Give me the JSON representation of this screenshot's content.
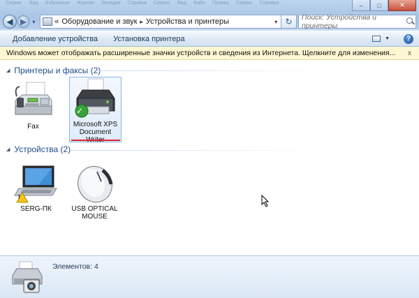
{
  "window": {
    "ghost_menu": [
      "Сервис",
      "Вид",
      "Избранное",
      "Журнал",
      "Вкладки",
      "Справка",
      "Сервис",
      "Вид",
      "Файл",
      "Правка",
      "Сервис",
      "Справка"
    ],
    "controls": [
      "–",
      "□",
      "✕"
    ]
  },
  "nav": {
    "back_glyph": "◀",
    "forward_glyph": "▶",
    "history_glyph": "▾"
  },
  "address": {
    "overflow": "«",
    "crumbs": [
      "Оборудование и звук",
      "Устройства и принтеры"
    ],
    "separator": "▸",
    "dropdown_glyph": "▾",
    "refresh_glyph": "↻"
  },
  "search": {
    "placeholder": "Поиск: Устройства и принтеры"
  },
  "commands": {
    "add_device": "Добавление устройства",
    "add_printer": "Установка принтера",
    "help": "?",
    "view_drop": "▼"
  },
  "infobar": {
    "text": "Windows может отображать расширенные значки устройств и сведения из Интернета.  Щелкните для изменения...",
    "close": "x"
  },
  "groups": [
    {
      "title": "Принтеры и факсы (2)",
      "items": [
        {
          "label": [
            "Fax"
          ],
          "icon": "fax-icon"
        },
        {
          "label": [
            "Microsoft XPS",
            "Document Writer"
          ],
          "icon": "printer-icon",
          "selected": true,
          "default_badge": "✓"
        }
      ]
    },
    {
      "title": "Устройства (2)",
      "items": [
        {
          "label": [
            "SERG-ПК"
          ],
          "icon": "laptop-icon",
          "warning_badge": "!"
        },
        {
          "label": [
            "USB OPTICAL",
            "MOUSE"
          ],
          "icon": "mouse-icon"
        }
      ]
    }
  ],
  "chevron_glyph": "◢",
  "details": {
    "count": "Элементов: 4"
  },
  "colors": {
    "accent": "#1e4c8a",
    "infobar": "#fcf7d2",
    "underline": "#e0222c"
  }
}
